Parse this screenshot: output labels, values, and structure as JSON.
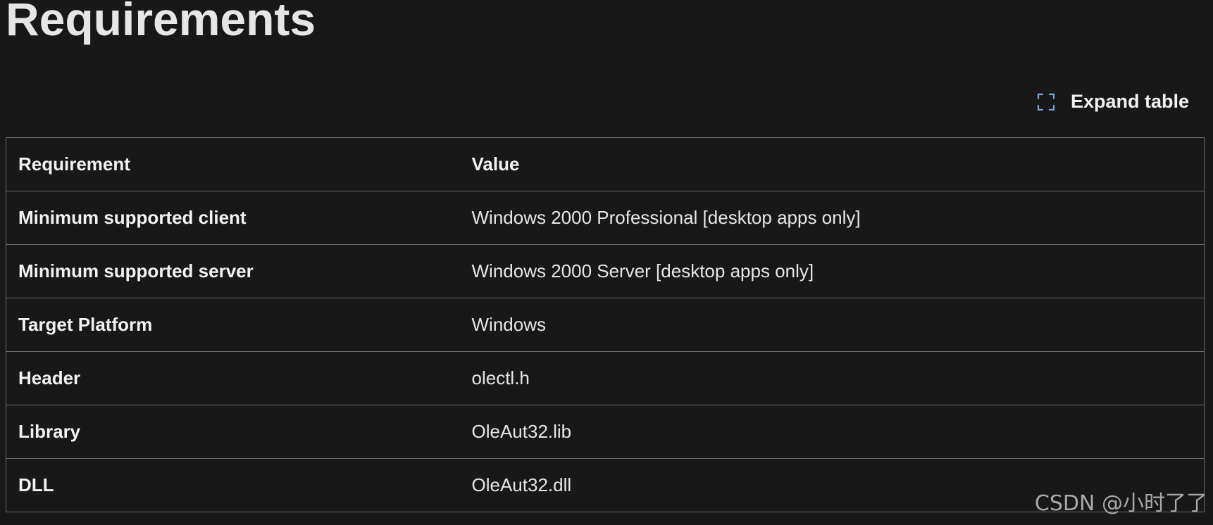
{
  "page": {
    "title": "Requirements"
  },
  "toolbar": {
    "expand_label": "Expand table",
    "expand_icon": "expand-icon"
  },
  "table": {
    "headers": [
      "Requirement",
      "Value"
    ],
    "rows": [
      {
        "requirement": "Minimum supported client",
        "value": "Windows 2000 Professional [desktop apps only]"
      },
      {
        "requirement": "Minimum supported server",
        "value": "Windows 2000 Server [desktop apps only]"
      },
      {
        "requirement": "Target Platform",
        "value": "Windows"
      },
      {
        "requirement": "Header",
        "value": "olectl.h"
      },
      {
        "requirement": "Library",
        "value": "OleAut32.lib"
      },
      {
        "requirement": "DLL",
        "value": "OleAut32.dll"
      }
    ]
  },
  "watermark": "CSDN @小时了了",
  "colors": {
    "background": "#181818",
    "text": "#e6e6e6",
    "border": "#6b6b6b",
    "icon_accent": "#6fa8dc"
  }
}
